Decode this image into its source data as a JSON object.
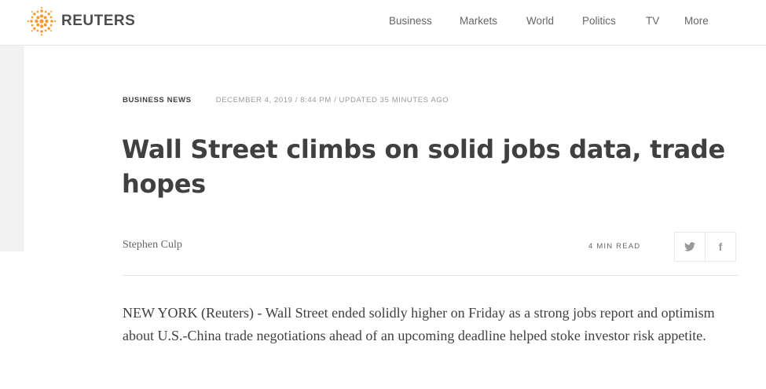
{
  "header": {
    "logo_text": "REUTERS",
    "nav": [
      "Business",
      "Markets",
      "World",
      "Politics",
      "TV",
      "More"
    ]
  },
  "article": {
    "channel": "BUSINESS NEWS",
    "date": "DECEMBER 4, 2019 / 8:44 PM / UPDATED 35 MINUTES AGO",
    "headline": "Wall Street climbs on solid jobs data, trade hopes",
    "author": "Stephen Culp",
    "read_time": "4 MIN READ",
    "share_icons": [
      "twitter-icon",
      "facebook-icon"
    ],
    "body": "NEW YORK (Reuters) - Wall Street ended solidly higher on Friday as a strong jobs report and optimism about U.S.-China trade negotiations ahead of an upcoming deadline helped stoke investor risk appetite."
  },
  "colors": {
    "logo_orange": "#f39c31",
    "text_dark": "#404040",
    "text_gray": "#999999",
    "border": "#e6e6e6"
  }
}
